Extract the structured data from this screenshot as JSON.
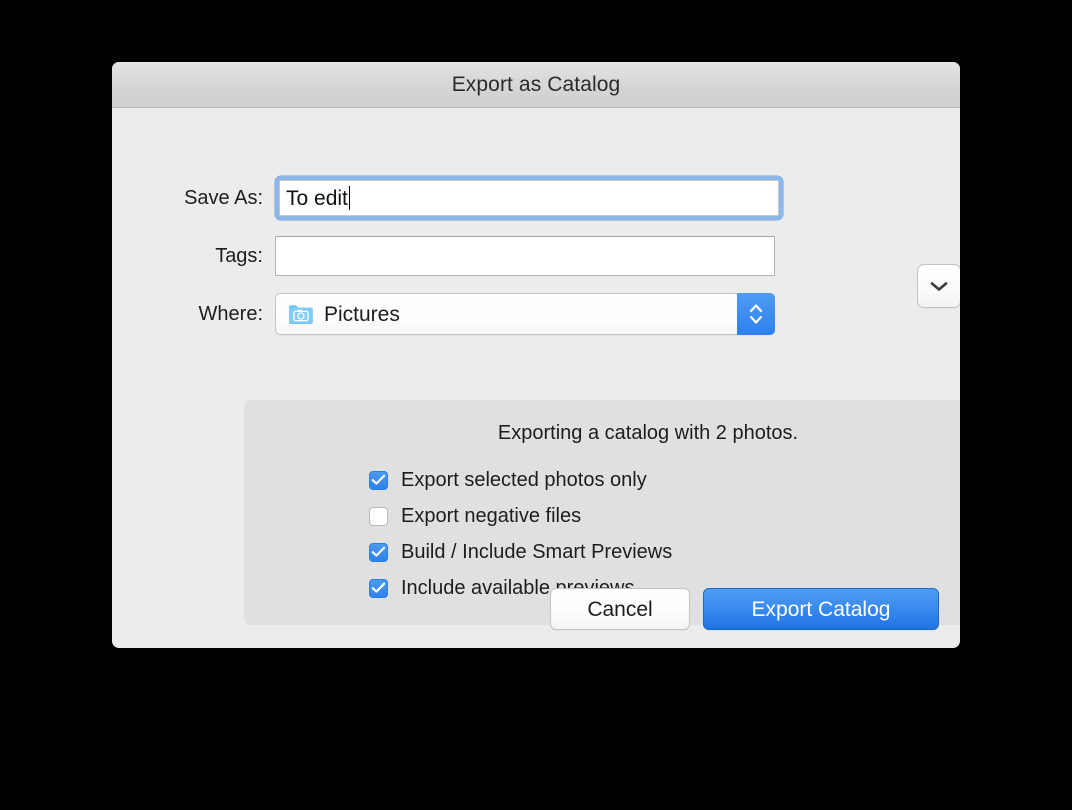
{
  "dialog": {
    "title": "Export as Catalog"
  },
  "fields": {
    "save_as": {
      "label": "Save As:",
      "value": "To edit",
      "placeholder": "",
      "expand_icon": "chevron-down-icon"
    },
    "tags": {
      "label": "Tags:",
      "value": "",
      "placeholder": ""
    },
    "where": {
      "label": "Where:",
      "value": "Pictures",
      "icon": "pictures-folder-icon",
      "stepper_icon": "up-down-chevron-icon"
    }
  },
  "options_panel": {
    "caption": "Exporting a catalog with 2 photos.",
    "checkboxes": [
      {
        "label": "Export selected photos only",
        "checked": true
      },
      {
        "label": "Export negative files",
        "checked": false
      },
      {
        "label": "Build / Include Smart Previews",
        "checked": true
      },
      {
        "label": "Include available previews",
        "checked": true
      }
    ]
  },
  "buttons": {
    "cancel": "Cancel",
    "primary": "Export Catalog"
  },
  "colors": {
    "accent_blue": "#3b8bf0",
    "focus_ring": "#8cb7e8",
    "dialog_bg": "#ececec",
    "panel_bg": "#e0e0e0",
    "titlebar_bg": "#d6d6d6",
    "desktop_bg": "#000000"
  }
}
